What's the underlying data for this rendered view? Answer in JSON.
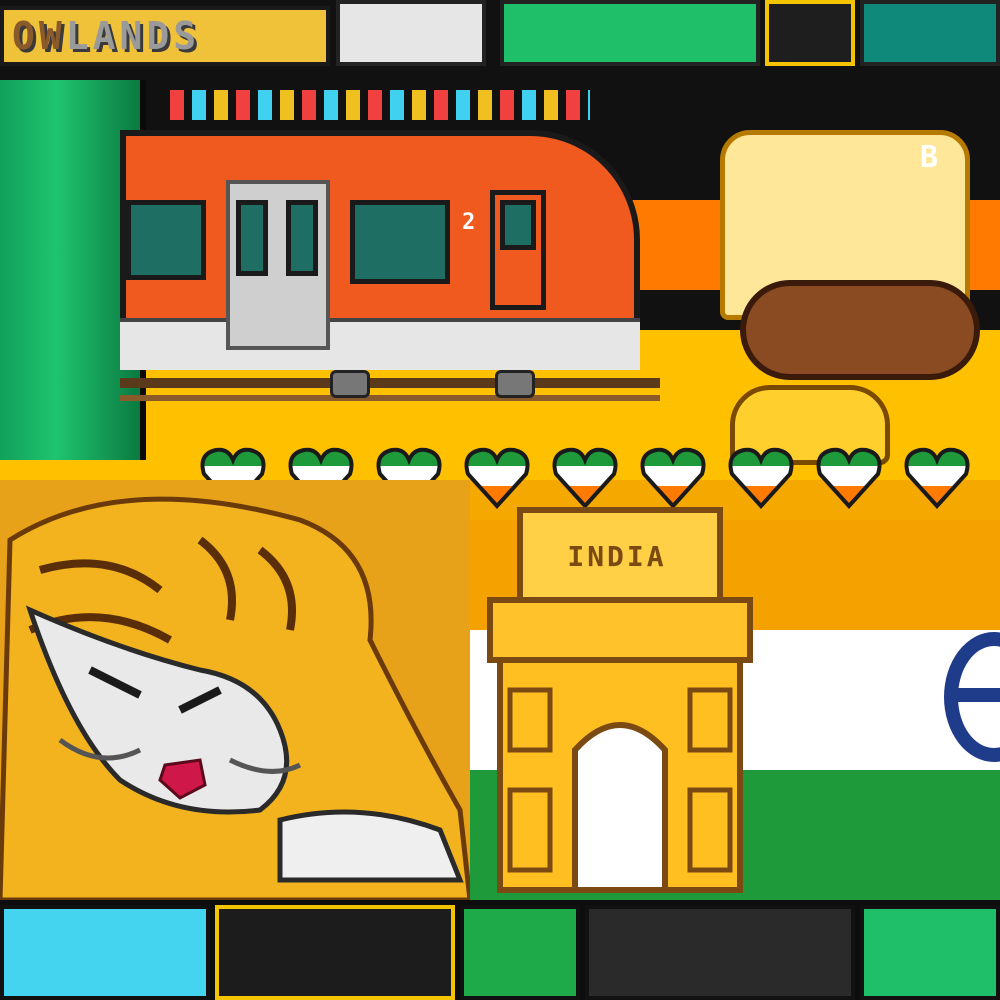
{
  "banner": {
    "pre_text": "OW",
    "text": "LANDS"
  },
  "gate": {
    "label": "INDIA"
  },
  "train": {
    "car_number": "2"
  },
  "beer": {
    "text": "B"
  },
  "colors": {
    "saffron": "#ff7a00",
    "orange": "#f5a200",
    "white": "#ffffff",
    "green": "#1f9a3a",
    "navy": "#1f3c8a",
    "train_red": "#f05a1e",
    "gold": "#ffc000"
  },
  "hearts": {
    "count": 9
  }
}
